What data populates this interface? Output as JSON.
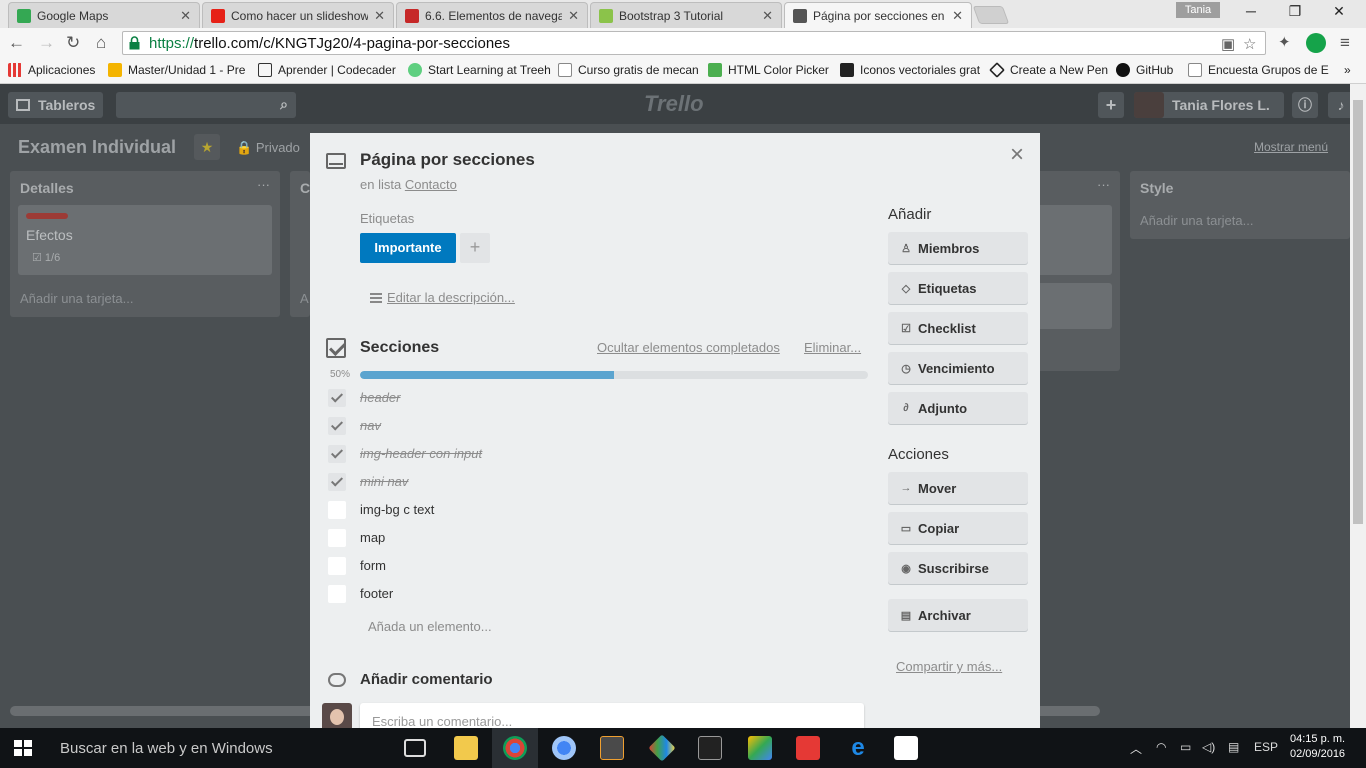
{
  "browser": {
    "tabs": [
      {
        "title": "Google Maps",
        "color": "#34a853"
      },
      {
        "title": "Como hacer un slideshow",
        "color": "#e62117"
      },
      {
        "title": "6.6. Elementos de navegac",
        "color": "#c62828"
      },
      {
        "title": "Bootstrap 3 Tutorial",
        "color": "#8bc34a"
      },
      {
        "title": "Página por secciones en E",
        "color": "#555555"
      }
    ],
    "profile_name": "Tania",
    "url_scheme": "https://",
    "url_rest": "trello.com/c/KNGTJg20/4-pagina-por-secciones",
    "bookmarks": [
      {
        "label": "Aplicaciones",
        "icon": "apps-grid-icon",
        "color": "#e53935"
      },
      {
        "label": "Master/Unidad 1 - Pre",
        "icon": "folder-icon",
        "color": "#f4b400"
      },
      {
        "label": "Aprender | Codecader",
        "icon": "codecademy-icon",
        "color": "#333333"
      },
      {
        "label": "Start Learning at Treeh",
        "icon": "treehouse-icon",
        "color": "#5fcf80"
      },
      {
        "label": "Curso gratis de mecan",
        "icon": "page-icon",
        "color": "#ffffff"
      },
      {
        "label": "HTML Color Picker",
        "icon": "w3-icon",
        "color": "#4caf50"
      },
      {
        "label": "Iconos vectoriales grat",
        "icon": "flaticon-icon",
        "color": "#222222"
      },
      {
        "label": "Create a New Pen",
        "icon": "codepen-icon",
        "color": "#222222"
      },
      {
        "label": "GitHub",
        "icon": "github-icon",
        "color": "#111111"
      },
      {
        "label": "Encuesta Grupos de E",
        "icon": "page-icon",
        "color": "#ffffff"
      }
    ],
    "more_bookmarks": "»"
  },
  "trello": {
    "boards_label": "Tableros",
    "logo": "Trello",
    "user_name": "Tania Flores L.",
    "board_title": "Examen Individual",
    "privacy": "Privado",
    "show_menu": "Mostrar menú",
    "lists": [
      {
        "title": "Detalles",
        "card_title": "Efectos",
        "card_badge": "1/6",
        "add_card": "Añadir una tarjeta..."
      },
      {
        "title": "C",
        "add_card": "A"
      },
      {
        "title": "Style",
        "add_card": "Añadir una tarjeta..."
      }
    ],
    "list_menu": "···"
  },
  "modal": {
    "close": "×",
    "title": "Página por secciones",
    "in_list_prefix": "en lista",
    "list_name": "Contacto",
    "labels_caption": "Etiquetas",
    "label": {
      "name": "Importante",
      "color": "#0079bf"
    },
    "label_add": "+",
    "edit_description": "Editar la descripción...",
    "checklist": {
      "title": "Secciones",
      "hide_completed": "Ocultar elementos completados",
      "delete": "Eliminar...",
      "percent_text": "50%",
      "progress": 0.5,
      "items": [
        {
          "text": "header",
          "done": true
        },
        {
          "text": "nav",
          "done": true
        },
        {
          "text": "img-header con input",
          "done": true
        },
        {
          "text": "mini nav",
          "done": true
        },
        {
          "text": "img-bg c text",
          "done": false
        },
        {
          "text": "map",
          "done": false
        },
        {
          "text": "form",
          "done": false
        },
        {
          "text": "footer",
          "done": false
        }
      ],
      "add_item": "Añada un elemento..."
    },
    "comment": {
      "title": "Añadir comentario",
      "placeholder": "Escriba un comentario..."
    },
    "sidebar": {
      "add_heading": "Añadir",
      "add_buttons": [
        {
          "label": "Miembros",
          "icon": "person-icon"
        },
        {
          "label": "Etiquetas",
          "icon": "tag-icon"
        },
        {
          "label": "Checklist",
          "icon": "checkbox-icon"
        },
        {
          "label": "Vencimiento",
          "icon": "clock-icon"
        },
        {
          "label": "Adjunto",
          "icon": "paperclip-icon"
        }
      ],
      "actions_heading": "Acciones",
      "action_buttons": [
        {
          "label": "Mover",
          "icon": "arrow-right-icon"
        },
        {
          "label": "Copiar",
          "icon": "card-icon"
        },
        {
          "label": "Suscribirse",
          "icon": "eye-icon"
        },
        {
          "label": "Archivar",
          "icon": "archive-icon"
        }
      ],
      "share": "Compartir y más..."
    }
  },
  "taskbar": {
    "search": "Buscar en la web y en Windows",
    "lang": "ESP",
    "time": "04:15 p. m.",
    "date": "02/09/2016"
  }
}
